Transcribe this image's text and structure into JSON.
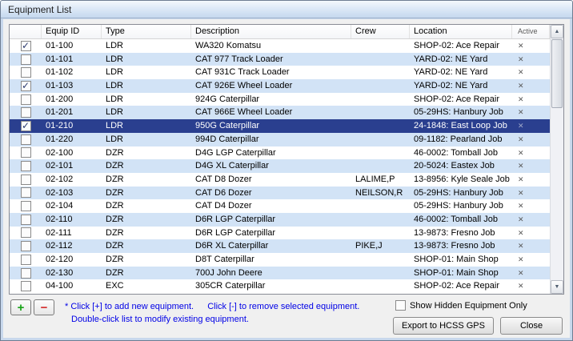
{
  "window": {
    "title": "Equipment List"
  },
  "table": {
    "headers": [
      "Equip ID",
      "Type",
      "Description",
      "Crew",
      "Location",
      "Active"
    ],
    "rows": [
      {
        "checked": true,
        "selected": false,
        "equip_id": "01-100",
        "type": "LDR",
        "description": "WA320 Komatsu",
        "crew": "",
        "location": "SHOP-02: Ace Repair",
        "active": true
      },
      {
        "checked": false,
        "selected": false,
        "equip_id": "01-101",
        "type": "LDR",
        "description": "CAT 977 Track Loader",
        "crew": "",
        "location": "YARD-02: NE Yard",
        "active": true
      },
      {
        "checked": false,
        "selected": false,
        "equip_id": "01-102",
        "type": "LDR",
        "description": "CAT 931C Track Loader",
        "crew": "",
        "location": "YARD-02: NE Yard",
        "active": true
      },
      {
        "checked": true,
        "selected": false,
        "equip_id": "01-103",
        "type": "LDR",
        "description": "CAT 926E Wheel Loader",
        "crew": "",
        "location": "YARD-02: NE Yard",
        "active": true
      },
      {
        "checked": false,
        "selected": false,
        "equip_id": "01-200",
        "type": "LDR",
        "description": "924G Caterpillar",
        "crew": "",
        "location": "SHOP-02: Ace Repair",
        "active": true
      },
      {
        "checked": false,
        "selected": false,
        "equip_id": "01-201",
        "type": "LDR",
        "description": "CAT 966E Wheel Loader",
        "crew": "",
        "location": "05-29HS: Hanbury Job",
        "active": true
      },
      {
        "checked": true,
        "selected": true,
        "equip_id": "01-210",
        "type": "LDR",
        "description": "950G Caterpillar",
        "crew": "",
        "location": "24-1848: East Loop Job",
        "active": true
      },
      {
        "checked": false,
        "selected": false,
        "equip_id": "01-220",
        "type": "LDR",
        "description": "994D Caterpillar",
        "crew": "",
        "location": "09-1182: Pearland Job",
        "active": true
      },
      {
        "checked": false,
        "selected": false,
        "equip_id": "02-100",
        "type": "DZR",
        "description": "D4G LGP Caterpillar",
        "crew": "",
        "location": "46-0002: Tomball Job",
        "active": true
      },
      {
        "checked": false,
        "selected": false,
        "equip_id": "02-101",
        "type": "DZR",
        "description": "D4G XL Caterpillar",
        "crew": "",
        "location": "20-5024: Eastex Job",
        "active": true
      },
      {
        "checked": false,
        "selected": false,
        "equip_id": "02-102",
        "type": "DZR",
        "description": "CAT D8 Dozer",
        "crew": "LALIME,P",
        "location": "13-8956: Kyle Seale Job",
        "active": true
      },
      {
        "checked": false,
        "selected": false,
        "equip_id": "02-103",
        "type": "DZR",
        "description": "CAT D6 Dozer",
        "crew": "NEILSON,R",
        "location": "05-29HS: Hanbury Job",
        "active": true
      },
      {
        "checked": false,
        "selected": false,
        "equip_id": "02-104",
        "type": "DZR",
        "description": "CAT D4 Dozer",
        "crew": "",
        "location": "05-29HS: Hanbury Job",
        "active": true
      },
      {
        "checked": false,
        "selected": false,
        "equip_id": "02-110",
        "type": "DZR",
        "description": "D6R LGP Caterpillar",
        "crew": "",
        "location": "46-0002: Tomball Job",
        "active": true
      },
      {
        "checked": false,
        "selected": false,
        "equip_id": "02-111",
        "type": "DZR",
        "description": "D6R LGP Caterpillar",
        "crew": "",
        "location": "13-9873: Fresno Job",
        "active": true
      },
      {
        "checked": false,
        "selected": false,
        "equip_id": "02-112",
        "type": "DZR",
        "description": "D6R XL Caterpillar",
        "crew": "PIKE,J",
        "location": "13-9873: Fresno Job",
        "active": true
      },
      {
        "checked": false,
        "selected": false,
        "equip_id": "02-120",
        "type": "DZR",
        "description": "D8T Caterpillar",
        "crew": "",
        "location": "SHOP-01: Main Shop",
        "active": true
      },
      {
        "checked": false,
        "selected": false,
        "equip_id": "02-130",
        "type": "DZR",
        "description": "700J John Deere",
        "crew": "",
        "location": "SHOP-01: Main Shop",
        "active": true
      },
      {
        "checked": false,
        "selected": false,
        "equip_id": "04-100",
        "type": "EXC",
        "description": "305CR Caterpillar",
        "crew": "",
        "location": "SHOP-02: Ace Repair",
        "active": true
      }
    ]
  },
  "icons": {
    "check_glyph": "✓",
    "active_mark": "✕",
    "up_arrow": "▲",
    "down_arrow": "▼",
    "plus": "+",
    "minus": "−"
  },
  "footer": {
    "hint_add": "* Click [+] to add new equipment.",
    "hint_remove": "Click [-] to remove selected equipment.",
    "hint_modify": "Double-click list to modify existing equipment.",
    "show_hidden_label": "Show Hidden Equipment Only",
    "export_label": "Export to HCSS GPS",
    "close_label": "Close"
  },
  "colors": {
    "selection": "#2A3F8F",
    "row_alt": "#D2E3F6",
    "hint_text": "#0000E6"
  }
}
